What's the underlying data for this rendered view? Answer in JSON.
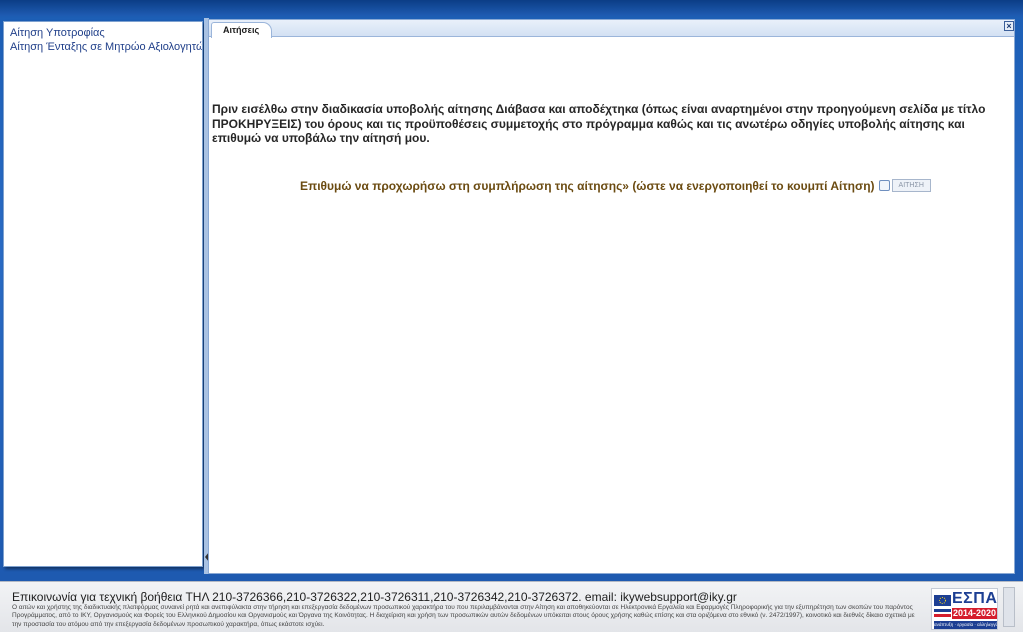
{
  "sidebar": {
    "items": [
      {
        "label": "Αίτηση Υποτροφίας"
      },
      {
        "label": "Αίτηση Ένταξης σε Μητρώο Αξιολογητών"
      }
    ]
  },
  "main": {
    "tab_label": "Αιτήσεις",
    "close_symbol": "×",
    "intro_text": "Πριν εισέλθω στην διαδικασία υποβολής αίτησης Διάβασα και αποδέχτηκα (όπως είναι αναρτημένοι στην προηγούμενη σελίδα με τίτλο ΠΡΟΚΗΡΥΞΕΙΣ) του όρους και τις προϋποθέσεις συμμετοχής στο πρόγραμμα καθώς και τις ανωτέρω οδηγίες υποβολής αίτησης και επιθυμώ να υποβάλω την αίτησή μου.",
    "proceed_text": "Επιθυμώ να προχωρήσω στη συμπλήρωση της αίτησης» (ώστε να ενεργοποιηθεί το κουμπί Αίτηση)",
    "submit_label": "ΑΙΤΗΣΗ"
  },
  "footer": {
    "contact": "Επικοινωνία για τεχνική βοήθεια ΤΗΛ 210-3726366,210-3726322,210-3726311,210-3726342,210-3726372. email: ikywebsupport@iky.gr",
    "privacy": "Ο αιτών και χρήστης της διαδικτυακής πλατφόρμας συναινεί ρητά και ανεπιφύλακτα στην τήρηση και επεξεργασία δεδομένων προσωπικού χαρακτήρα του που περιλαμβάνονται στην Αίτηση και αποθηκεύονται σε Ηλεκτρονικά Εργαλεία και Εφαρμογές Πληροφορικής για την εξυπηρέτηση των σκοπών του παρόντος Προγράμματος, από το ΙΚΥ, Οργανισμούς και Φορείς του Ελληνικού Δημοσίου και Οργανισμούς και Όργανα της Κοινότητας. Η διαχείριση και χρήση των προσωπικών αυτών δεδομένων υπόκειται στους όρους χρήσης καθώς επίσης και στα οριζόμενα στο εθνικό (ν. 2472/1997), κοινοτικό και διεθνές δίκαιο σχετικά με την προστασία του ατόμου από την επεξεργασία δεδομένων προσωπικού χαρακτήρα, όπως εκάστοτε ισχύει.",
    "logo": {
      "title": "ΕΣΠΑ",
      "years": "2014-2020",
      "tagline": "ανάπτυξη · εργασία · αλληλεγγύη"
    }
  },
  "colors": {
    "background": "#2a6bc4",
    "sidebar_link": "#21408a",
    "proceed_text": "#6b4b11",
    "espa_blue": "#1d3f93",
    "espa_red": "#d51e2d"
  }
}
